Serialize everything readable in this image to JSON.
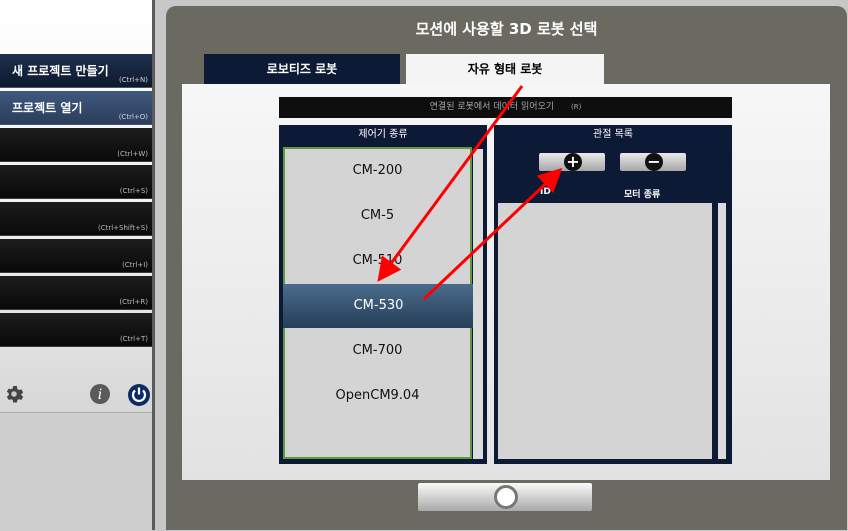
{
  "menu": {
    "items": [
      {
        "label": "새 프로젝트 만들기",
        "shortcut": "(Ctrl+N)"
      },
      {
        "label": "프로젝트 열기",
        "shortcut": "(Ctrl+O)"
      },
      {
        "label": "",
        "shortcut": "(Ctrl+W)"
      },
      {
        "label": "",
        "shortcut": "(Ctrl+S)"
      },
      {
        "label": "",
        "shortcut": "(Ctrl+Shift+S)"
      },
      {
        "label": "",
        "shortcut": "(Ctrl+I)"
      },
      {
        "label": "",
        "shortcut": "(Ctrl+R)"
      },
      {
        "label": "",
        "shortcut": "(Ctrl+T)"
      }
    ]
  },
  "dialog": {
    "title": "모션에 사용할 3D 로봇 선택",
    "tabs": [
      "로보티즈 로봇",
      "자유 형태 로봇"
    ],
    "status_text": "연결된 로봇에서 데이터 읽어오기",
    "status_shortcut": "(R)",
    "controller_panel": {
      "header": "제어기 종류",
      "items": [
        "CM-200",
        "CM-5",
        "CM-510",
        "CM-530",
        "CM-700",
        "OpenCM9.04"
      ],
      "selected": "CM-530"
    },
    "joint_panel": {
      "header": "관절 목록",
      "add_symbol": "+",
      "remove_symbol": "−",
      "columns": [
        "ID",
        "모터 종류"
      ]
    }
  },
  "colors": {
    "accent_navy": "#0d1a36",
    "selection": "#2f4b6a",
    "annotation_arrow": "#ff0000"
  },
  "icons": [
    "gear-icon",
    "info-icon",
    "power-icon",
    "plus-icon",
    "minus-icon",
    "ok-circle-icon"
  ]
}
